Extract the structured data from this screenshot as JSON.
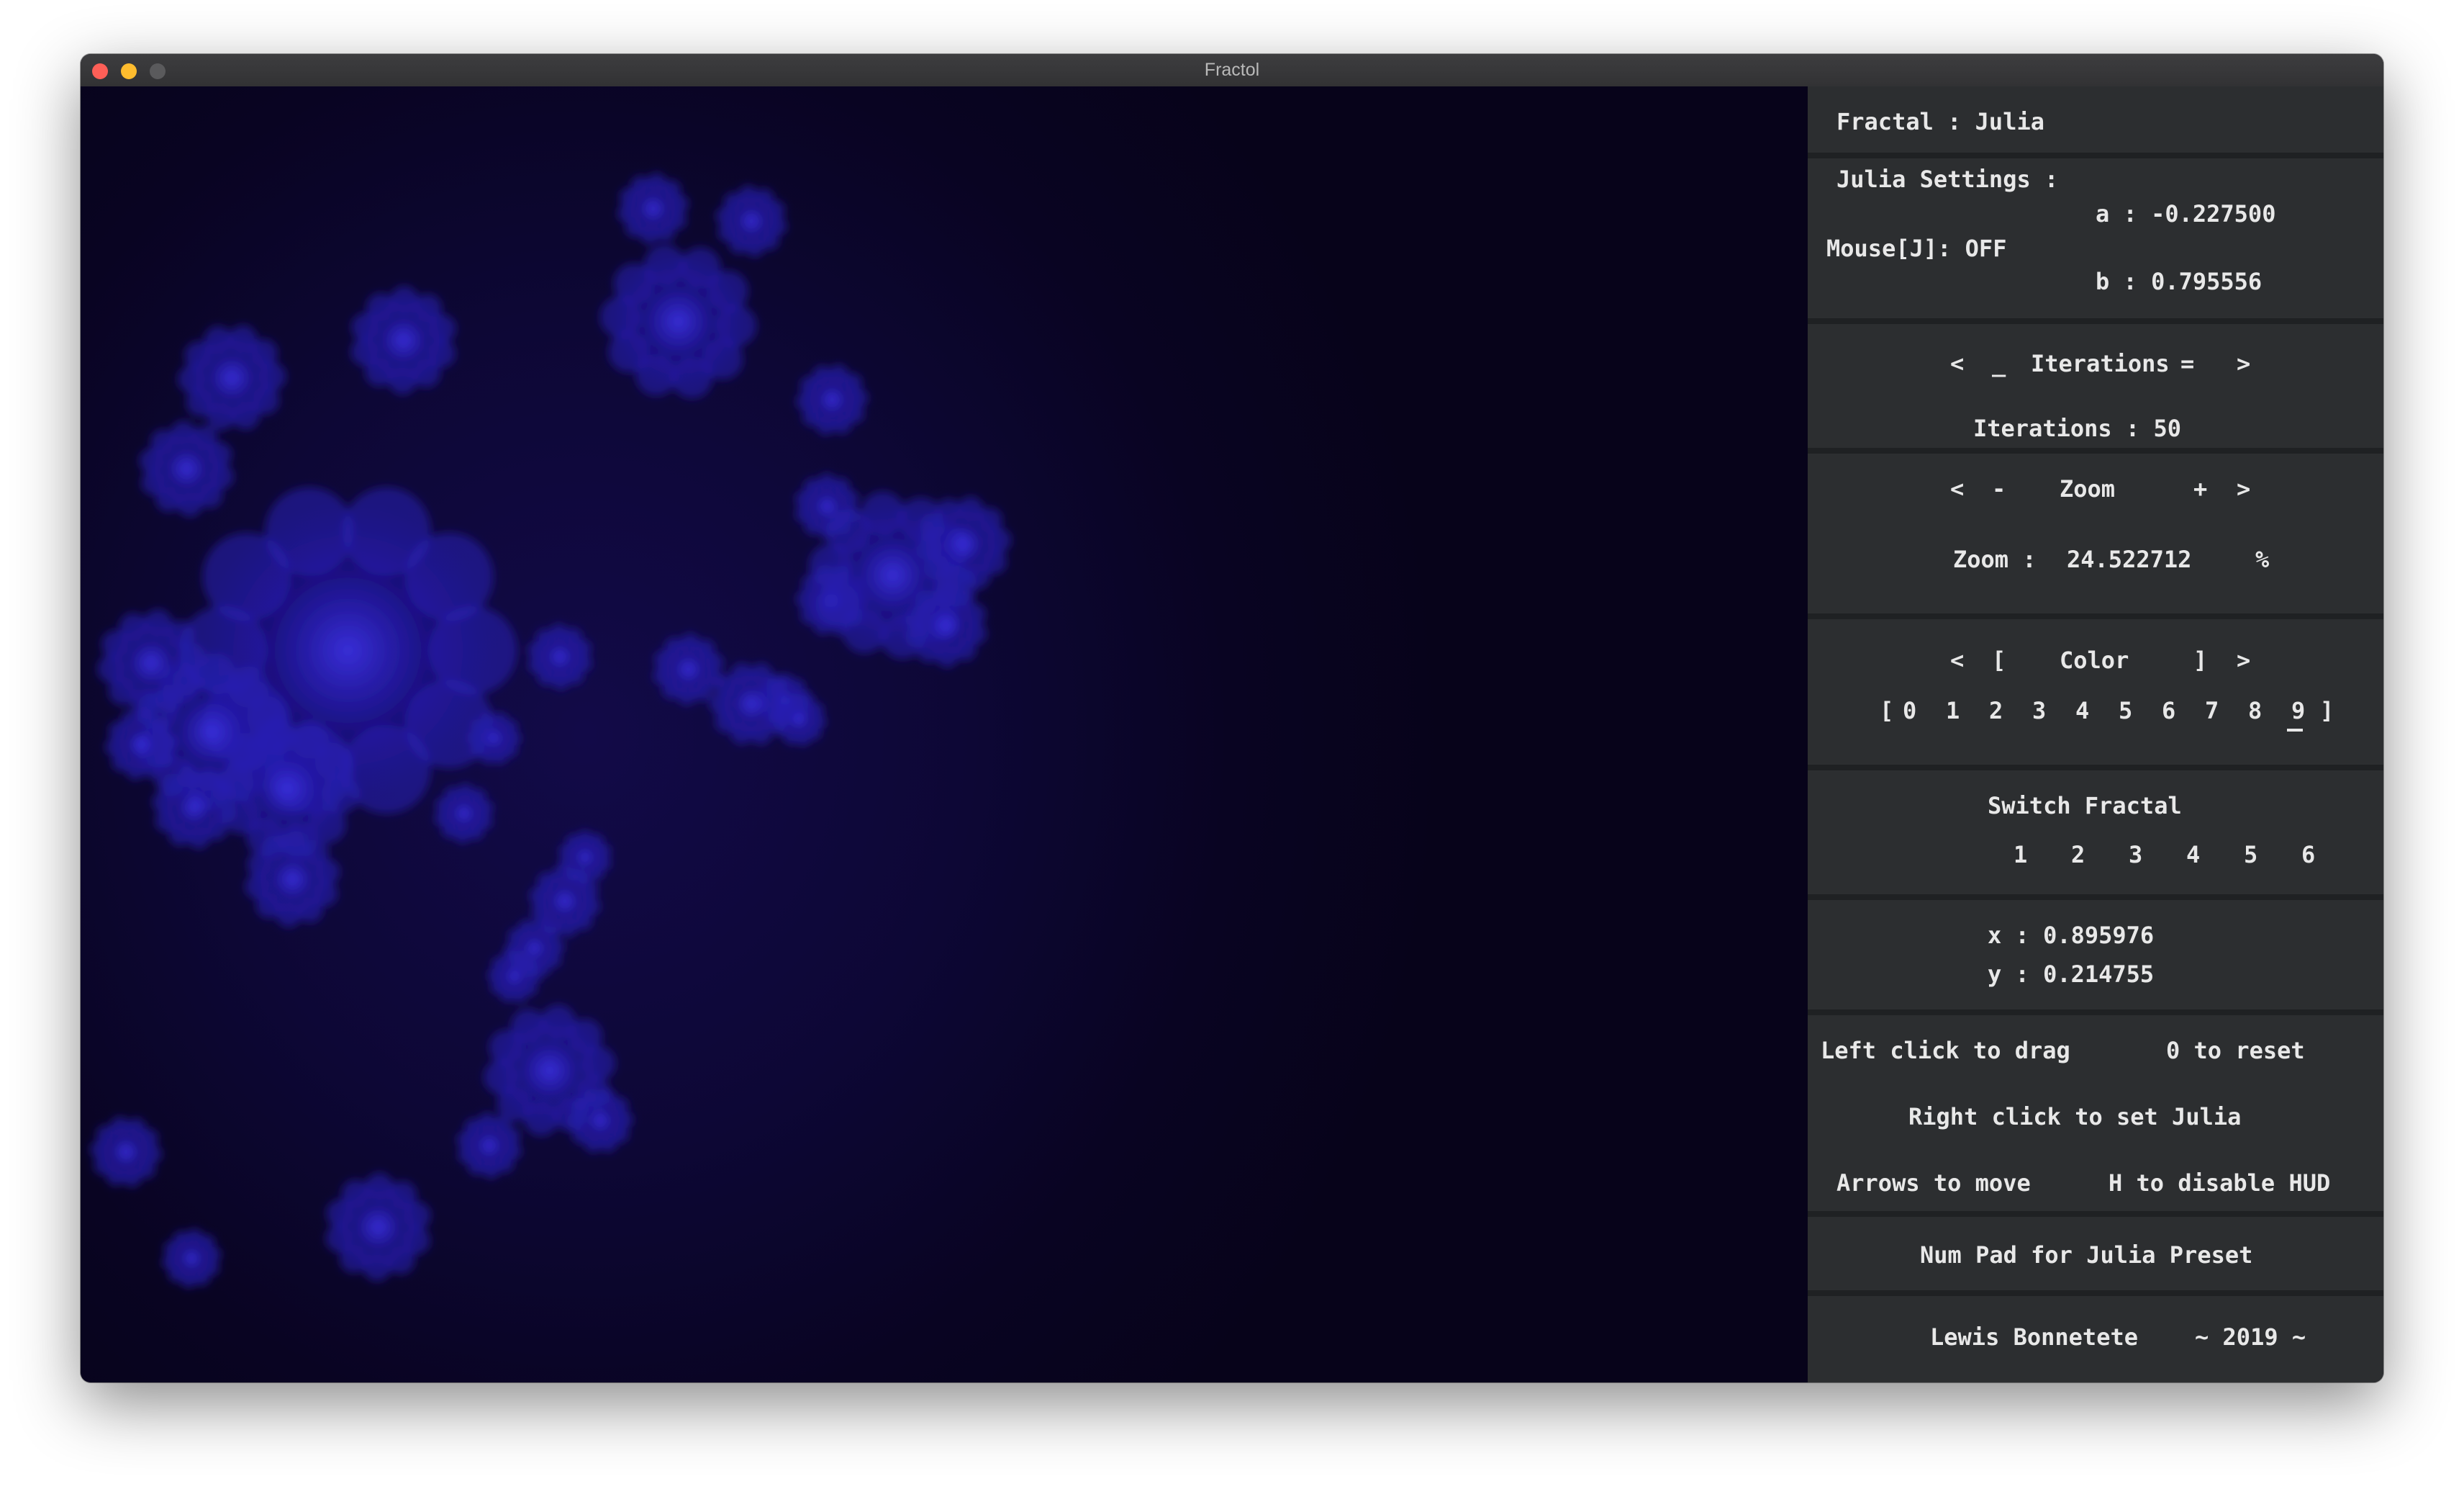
{
  "window": {
    "title": "Fractol"
  },
  "hud": {
    "fractal_label": "Fractal : Julia",
    "julia_settings_label": "Julia Settings :",
    "a_label": "a : -0.227500",
    "mouse_label": "Mouse[J]: OFF",
    "b_label": "b : 0.795556",
    "iter_left": "<",
    "iter_minus": "_",
    "iter_title": "Iterations",
    "iter_plus": "=",
    "iter_right": ">",
    "iterations_value": "Iterations : 50",
    "zoom_left": "<",
    "zoom_minus": "-",
    "zoom_title": "Zoom",
    "zoom_plus": "+",
    "zoom_right": ">",
    "zoom_label": "Zoom :",
    "zoom_value": "24.522712",
    "zoom_unit": "%",
    "color_left": "<",
    "color_open": "[",
    "color_title": "Color",
    "color_close": "]",
    "color_right": ">",
    "palette_open": "[",
    "palette_close": "]",
    "palettes": [
      "0",
      "1",
      "2",
      "3",
      "4",
      "5",
      "6",
      "7",
      "8",
      "9"
    ],
    "selected_palette": "9",
    "switch_title": "Switch Fractal",
    "fractals": [
      "1",
      "2",
      "3",
      "4",
      "5",
      "6"
    ],
    "x_label": "x : 0.895976",
    "y_label": "y : 0.214755",
    "help_drag": "Left click to drag",
    "help_reset": "0 to reset",
    "help_julia": "Right click to set Julia",
    "help_arrows": "Arrows to move",
    "help_hud": "H to disable HUD",
    "help_numpad": "Num Pad for Julia Preset",
    "author": "Lewis Bonnetete",
    "year": "~ 2019 ~"
  },
  "colors": {
    "hud_bg": "#1f2123",
    "section_bg": "#2c2e30",
    "text": "#e8e8e8",
    "fractal_glow": "#2a22c8",
    "fractal_bg": "#0a0520"
  }
}
